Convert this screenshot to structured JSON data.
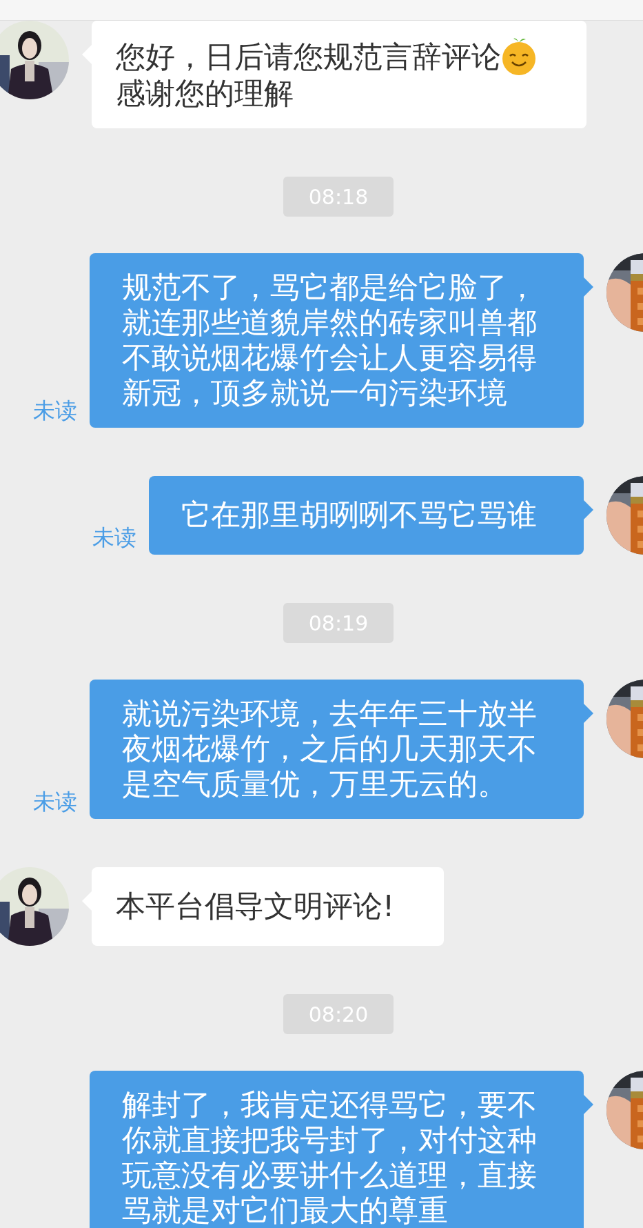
{
  "messages": [
    {
      "kind": "incoming",
      "lines": [
        "您好，日后请您规范言辞评论",
        "感谢您的理解"
      ],
      "emoji": true
    },
    {
      "kind": "time",
      "text": "08:18"
    },
    {
      "kind": "outgoing",
      "lines": [
        "规范不了，骂它都是给它脸了，",
        "就连那些道貌岸然的砖家叫兽都",
        "不敢说烟花爆竹会让人更容易得",
        "新冠，顶多就说一句污染环境"
      ],
      "status": "未读"
    },
    {
      "kind": "outgoing",
      "lines": [
        "它在那里胡咧咧不骂它骂谁"
      ],
      "status": "未读"
    },
    {
      "kind": "time",
      "text": "08:19"
    },
    {
      "kind": "outgoing",
      "lines": [
        "就说污染环境，去年年三十放半",
        "夜烟花爆竹，之后的几天那天不",
        "是空气质量优，万里无云的。"
      ],
      "status": "未读"
    },
    {
      "kind": "incoming",
      "lines": [
        "本平台倡导文明评论!"
      ],
      "emoji": false
    },
    {
      "kind": "time",
      "text": "08:20"
    },
    {
      "kind": "outgoing",
      "lines": [
        "解封了，我肯定还得骂它，要不",
        "你就直接把我号封了，对付这种",
        "玩意没有必要讲什么道理，直接",
        "骂就是对它们最大的尊重"
      ]
    }
  ]
}
